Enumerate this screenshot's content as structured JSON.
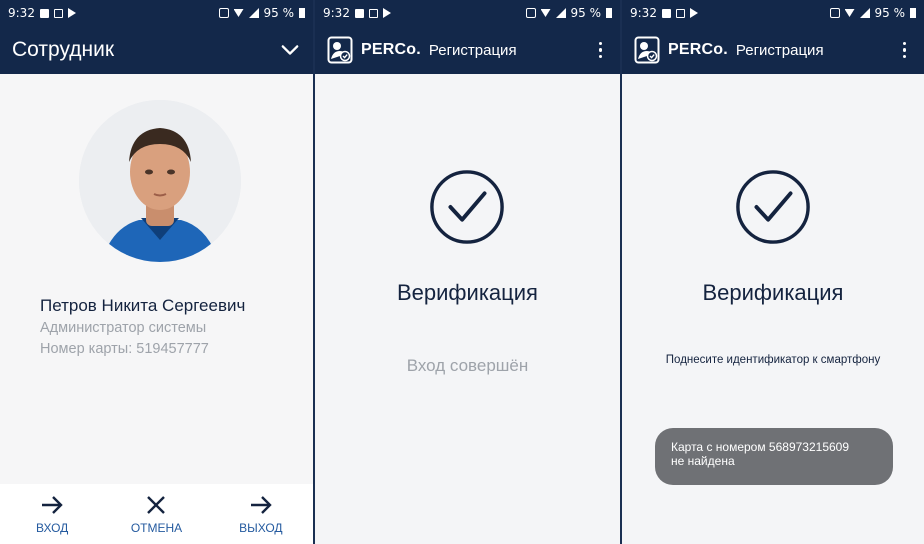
{
  "status_bars": [
    {
      "time": "9:32",
      "battery": "95 %"
    },
    {
      "time": "9:32",
      "battery": "95 %"
    },
    {
      "time": "9:32",
      "battery": "95 %"
    }
  ],
  "panel1": {
    "title": "Сотрудник",
    "employee": {
      "name": "Петров Никита Сергеевич",
      "role": "Администратор системы",
      "card": "Номер карты: 519457777"
    },
    "actions": {
      "enter": "ВХОД",
      "cancel": "ОТМЕНА",
      "exit": "ВЫХОД"
    }
  },
  "panel2": {
    "brand": "PERCo.",
    "app": "Регистрация",
    "heading": "Верификация",
    "message": "Вход совершён"
  },
  "panel3": {
    "brand": "PERCo.",
    "app": "Регистрация",
    "heading": "Верификация",
    "hint": "Поднесите идентификатор к смартфону",
    "toast_line1": "Карта с номером 568973215609",
    "toast_line2": "не найдена"
  },
  "colors": {
    "header": "#13284a",
    "accent": "#245a9f",
    "text_dark": "#14233f",
    "text_muted": "#9ea3aa"
  }
}
